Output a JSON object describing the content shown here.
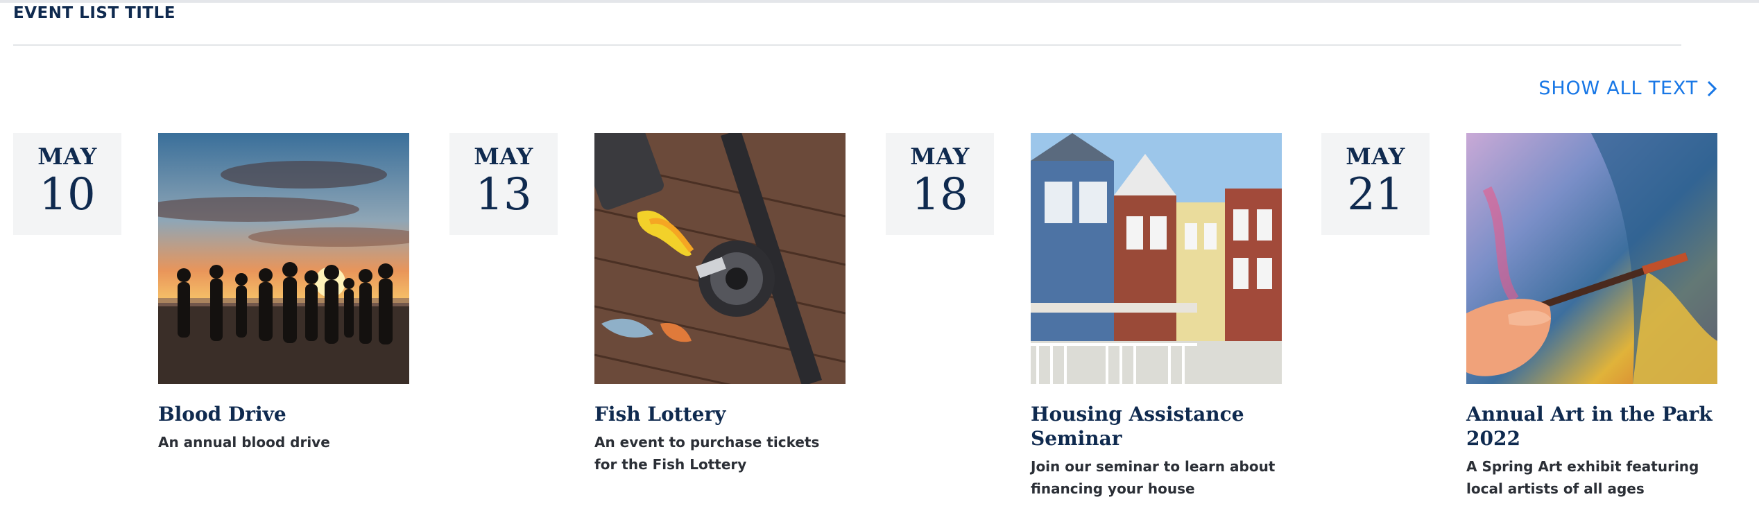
{
  "header": {
    "title": "EVENT LIST TITLE"
  },
  "show_all": {
    "label": "SHOW ALL TEXT",
    "icon": "chevron-right-icon"
  },
  "colors": {
    "accent": "#1877e6",
    "navy": "#0f2a4f",
    "date_bg": "#f3f4f5"
  },
  "events": [
    {
      "month": "MAY",
      "day": "10",
      "title": "Blood Drive",
      "description": "An annual blood drive",
      "image": "sunset-beach-family"
    },
    {
      "month": "MAY",
      "day": "13",
      "title": "Fish Lottery",
      "description": "An event to purchase tickets for the Fish Lottery",
      "image": "fishing-reel-on-dock"
    },
    {
      "month": "MAY",
      "day": "18",
      "title": "Housing Assistance Seminar",
      "description": "Join our seminar to learn about financing your house",
      "image": "townhouses"
    },
    {
      "month": "MAY",
      "day": "21",
      "title": "Annual Art in the Park 2022",
      "description": "A Spring Art exhibit featuring local artists of all ages",
      "image": "painting-hand"
    }
  ]
}
